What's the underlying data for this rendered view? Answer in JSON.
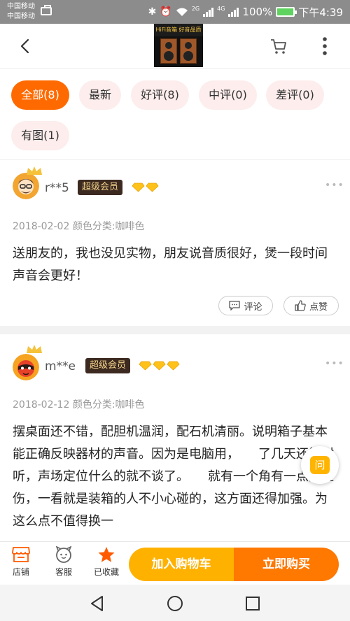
{
  "status_bar": {
    "carrier_1": "中国移动",
    "carrier_2": "中国移动",
    "net_1": "2G",
    "net_2": "4G",
    "battery": "100%",
    "time": "下午4:39"
  },
  "header": {
    "product_banner": "HiFi音箱 好音品质",
    "icons": [
      "back-icon",
      "cart-icon",
      "more-icon"
    ]
  },
  "filters": [
    {
      "label": "全部(8)",
      "active": true
    },
    {
      "label": "最新",
      "active": false
    },
    {
      "label": "好评(8)",
      "active": false
    },
    {
      "label": "中评(0)",
      "active": false
    },
    {
      "label": "差评(0)",
      "active": false
    },
    {
      "label": "有图(1)",
      "active": false
    }
  ],
  "reviews": [
    {
      "user": "r**5",
      "badge": "超级会员",
      "diamonds": 2,
      "date": "2018-02-02",
      "spec": "颜色分类:咖啡色",
      "text": "送朋友的，我也没见实物，朋友说音质很好，煲一段时间声音会更好！",
      "comment_label": "评论",
      "like_label": "点赞"
    },
    {
      "user": "m**e",
      "badge": "超级会员",
      "diamonds": 3,
      "date": "2018-02-12",
      "spec": "颜色分类:咖啡色",
      "text": "摆桌面还不错，配胆机温润，配石机清丽。说明箱子基本能正确反映器材的声音。因为是电脑用，　　了几天还算耐听，声场定位什么的就不谈了。　　就有一个角有一点点碰伤，一看就是装箱的人不小心碰的，这方面还得加强。为这么点不值得换一"
    }
  ],
  "ask_button": "问",
  "bottom_bar": {
    "shop": "店铺",
    "service": "客服",
    "favorited": "已收藏",
    "add_to_cart": "加入购物车",
    "buy_now": "立即购买"
  },
  "colors": {
    "accent": "#ff6a00",
    "chip_bg": "#fdeded",
    "cart_button": "#ffb100",
    "buy_button": "#ff7800",
    "vip_badge": "#3c2a20",
    "diamond": "#ffc21a"
  }
}
